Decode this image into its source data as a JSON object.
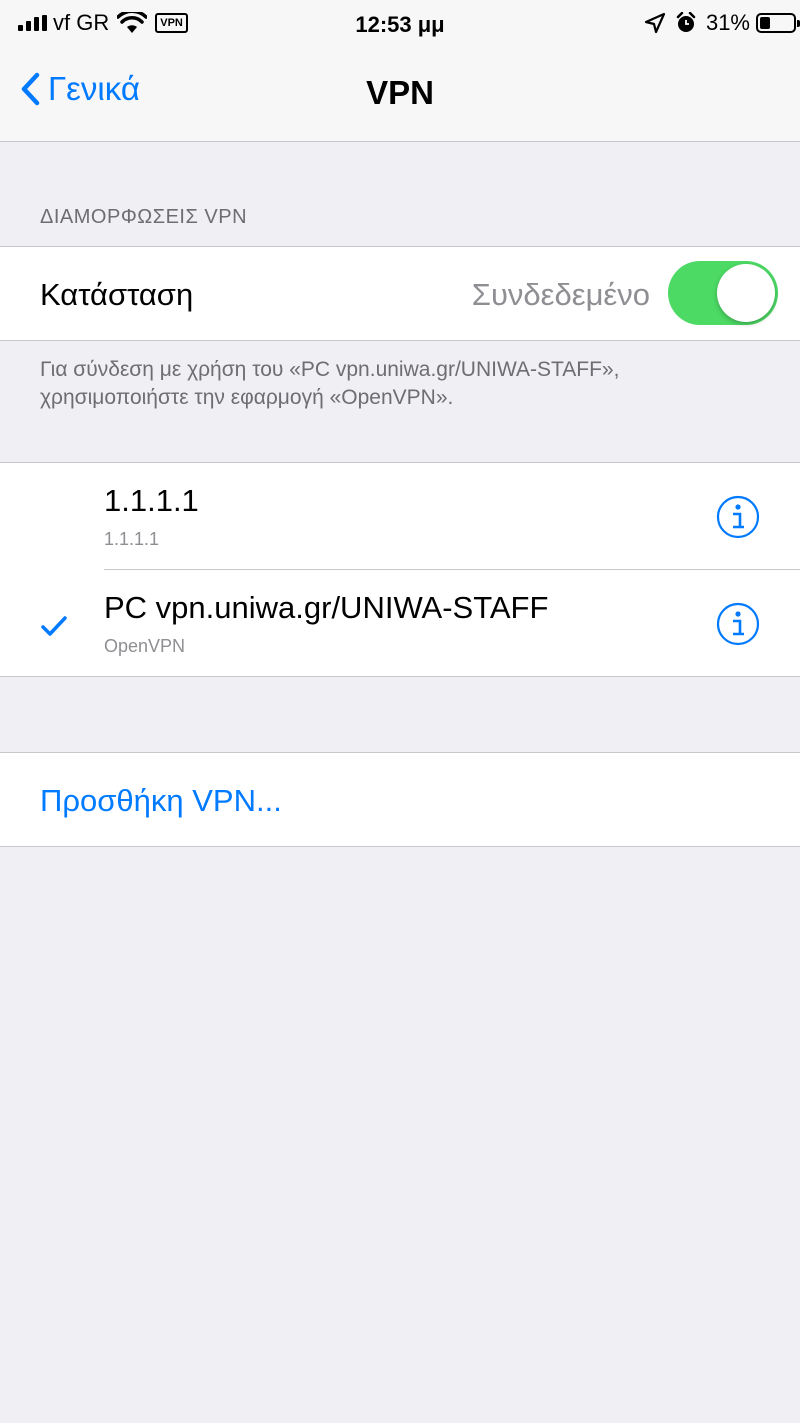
{
  "status_bar": {
    "carrier": "vf GR",
    "vpn_badge": "VPN",
    "time": "12:53 μμ",
    "battery_percent": "31%",
    "battery_level": 0.31,
    "icons": [
      "signal-icon",
      "wifi-icon",
      "location-icon",
      "alarm-icon",
      "battery-icon"
    ]
  },
  "nav": {
    "back_label": "Γενικά",
    "title": "VPN"
  },
  "config_section": {
    "header": "ΔΙΑΜΟΡΦΩΣΕΙΣ VPN",
    "status_label": "Κατάσταση",
    "status_value": "Συνδεδεμένο",
    "toggle_on": true,
    "footer": "Για σύνδεση με χρήση του «PC vpn.uniwa.gr/UNIWA-STAFF», χρησιμοποιήστε την εφαρμογή «OpenVPN»."
  },
  "vpn_list": [
    {
      "name": "1.1.1.1",
      "subtitle": "1.1.1.1",
      "selected": false
    },
    {
      "name": "PC vpn.uniwa.gr/UNIWA-STAFF",
      "subtitle": "OpenVPN",
      "selected": true
    }
  ],
  "add_vpn_label": "Προσθήκη VPN...",
  "colors": {
    "accent": "#007aff",
    "toggle_on": "#4cd964",
    "background": "#efeff4"
  }
}
